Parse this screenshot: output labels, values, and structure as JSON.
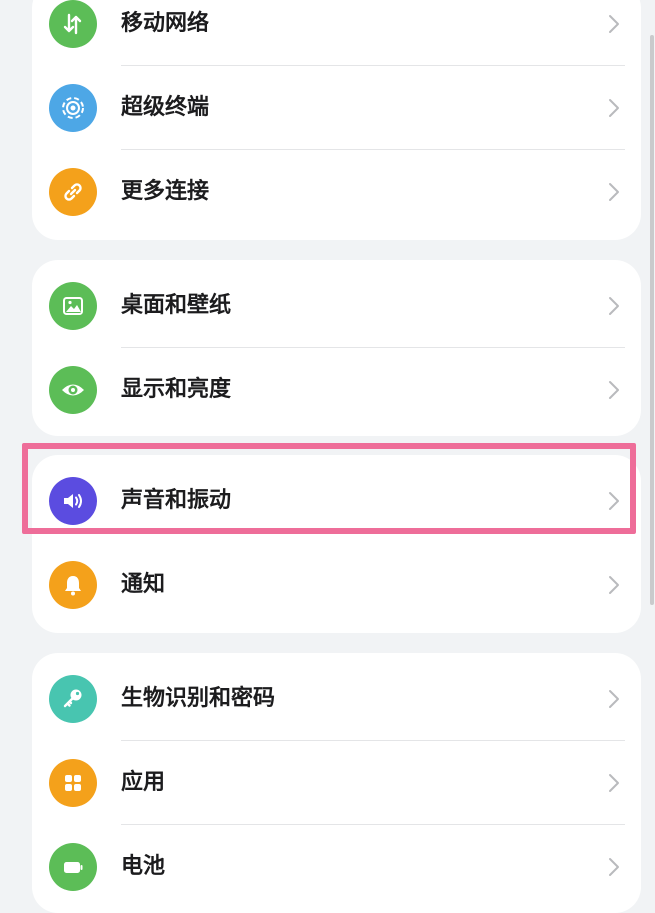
{
  "groups": [
    {
      "items": [
        {
          "label": "移动网络",
          "icon": "mobile-data-icon",
          "color": "#5cbd57"
        },
        {
          "label": "超级终端",
          "icon": "super-device-icon",
          "color": "#4da7e6"
        },
        {
          "label": "更多连接",
          "icon": "link-icon",
          "color": "#f4a11b"
        }
      ]
    },
    {
      "items": [
        {
          "label": "桌面和壁纸",
          "icon": "wallpaper-icon",
          "color": "#5cbd57"
        },
        {
          "label": "显示和亮度",
          "icon": "eye-icon",
          "color": "#5cbd57"
        }
      ]
    },
    {
      "items": [
        {
          "label": "声音和振动",
          "icon": "speaker-icon",
          "color": "#5b4ce0"
        },
        {
          "label": "通知",
          "icon": "bell-icon",
          "color": "#f4a11b"
        }
      ]
    },
    {
      "items": [
        {
          "label": "生物识别和密码",
          "icon": "key-icon",
          "color": "#48c5b0"
        },
        {
          "label": "应用",
          "icon": "apps-icon",
          "color": "#f4a11b"
        },
        {
          "label": "电池",
          "icon": "battery-icon",
          "color": "#5cbd57"
        }
      ]
    }
  ],
  "highlight_color": "#ee6d99"
}
